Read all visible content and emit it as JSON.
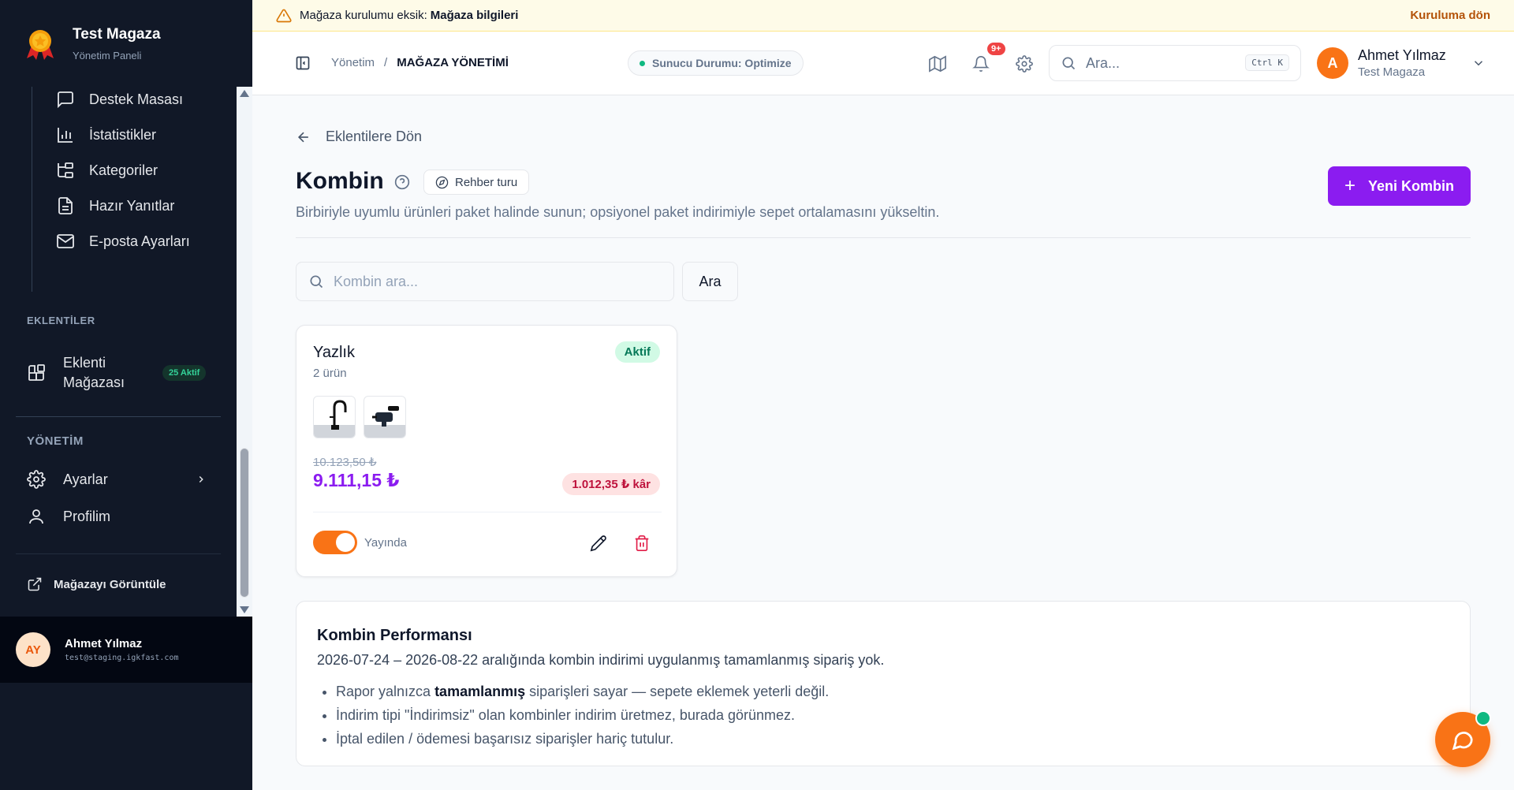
{
  "banner": {
    "prefix": "Mağaza kurulumu eksik:",
    "item": "Mağaza bilgileri",
    "action": "Kuruluma dön"
  },
  "sidebar": {
    "brand_title": "Test Magaza",
    "brand_subtitle": "Yönetim Paneli",
    "sub_items": [
      {
        "label": "Destek Masası",
        "icon": "message-square-icon"
      },
      {
        "label": "İstatistikler",
        "icon": "bar-chart-icon"
      },
      {
        "label": "Kategoriler",
        "icon": "folder-tree-icon"
      },
      {
        "label": "Hazır Yanıtlar",
        "icon": "file-text-icon"
      },
      {
        "label": "E-posta Ayarları",
        "icon": "mail-icon"
      }
    ],
    "section_plugins": "EKLENTİLER",
    "plugin_store_line1": "Eklenti",
    "plugin_store_line2": "Mağazası",
    "plugin_badge": "25 Aktif",
    "section_admin": "YÖNETİM",
    "settings": "Ayarlar",
    "profile": "Profilim",
    "view_store": "Mağazayı Görüntüle",
    "user_initials": "AY",
    "user_name": "Ahmet Yılmaz",
    "user_email": "test@staging.igkfast.com"
  },
  "header": {
    "breadcrumb_root": "Yönetim",
    "breadcrumb_sep": "/",
    "breadcrumb_current": "MAĞAZA YÖNETİMİ",
    "server_status": "Sunucu Durumu: Optimize",
    "notif_count": "9+",
    "search_placeholder": "Ara...",
    "search_shortcut": "Ctrl K",
    "user_initial": "A",
    "user_name": "Ahmet Yılmaz",
    "user_store": "Test Magaza"
  },
  "main": {
    "back_link": "Eklentilere Dön",
    "title": "Kombin",
    "guide_button": "Rehber turu",
    "subtitle": "Birbiriyle uyumlu ürünleri paket halinde sunun; opsiyonel paket indirimiyle sepet ortalamasını yükseltin.",
    "new_button": "Yeni Kombin",
    "search_placeholder": "Kombin ara...",
    "search_button": "Ara"
  },
  "combo_card": {
    "name": "Yazlık",
    "count": "2 ürün",
    "status": "Aktif",
    "old_price": "10.123,50 ₺",
    "price": "9.111,15 ₺",
    "profit": "1.012,35 ₺ kâr",
    "published_label": "Yayında",
    "published": true
  },
  "performance": {
    "title": "Kombin Performansı",
    "description": "2026-07-24 – 2026-08-22 aralığında kombin indirimi uygulanmış tamamlanmış sipariş yok.",
    "note1_pre": "Rapor yalnızca ",
    "note1_bold": "tamamlanmış",
    "note1_post": " siparişleri sayar — sepete eklemek yeterli değil.",
    "note2": "İndirim tipi \"İndirimsiz\" olan kombinler indirim üretmez, burada görünmez.",
    "note3": "İptal edilen / ödemesi başarısız siparişler hariç tutulur."
  },
  "colors": {
    "sidebar_bg": "#111827",
    "accent_purple": "#8b1cf0",
    "accent_orange": "#f97316",
    "success_green": "#047857",
    "danger_red": "#e11d48"
  }
}
